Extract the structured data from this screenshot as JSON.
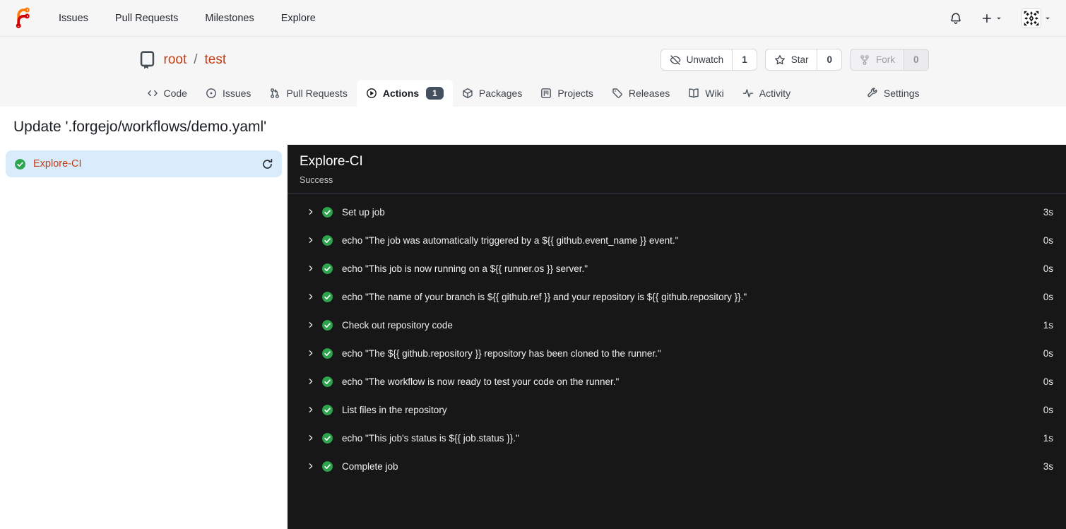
{
  "colors": {
    "accent_link": "#c53c14",
    "panel_bg": "#171717",
    "success_green": "#2da44e",
    "selected_job_bg": "#d9ecfc",
    "badge_bg": "#45505f"
  },
  "navbar": {
    "links": [
      {
        "label": "Issues"
      },
      {
        "label": "Pull Requests"
      },
      {
        "label": "Milestones"
      },
      {
        "label": "Explore"
      }
    ],
    "icons": {
      "logo": "forgejo-logo",
      "notifications": "bell-icon",
      "create_new": "plus-icon",
      "user_menu": "avatar-identicon"
    }
  },
  "repo_header": {
    "owner": "root",
    "separator": "/",
    "name": "test",
    "actions": [
      {
        "label": "Unwatch",
        "count": "1",
        "icon": "eye-slash",
        "disabled": false
      },
      {
        "label": "Star",
        "count": "0",
        "icon": "star",
        "disabled": false
      },
      {
        "label": "Fork",
        "count": "0",
        "icon": "fork",
        "disabled": true
      }
    ]
  },
  "tabs": [
    {
      "label": "Code",
      "icon": "code"
    },
    {
      "label": "Issues",
      "icon": "issue"
    },
    {
      "label": "Pull Requests",
      "icon": "pull-request"
    },
    {
      "label": "Actions",
      "icon": "play",
      "active": true,
      "badge": "1"
    },
    {
      "label": "Packages",
      "icon": "package"
    },
    {
      "label": "Projects",
      "icon": "project"
    },
    {
      "label": "Releases",
      "icon": "tag"
    },
    {
      "label": "Wiki",
      "icon": "book"
    },
    {
      "label": "Activity",
      "icon": "pulse"
    },
    {
      "label": "Settings",
      "icon": "tools",
      "align": "right"
    }
  ],
  "run": {
    "title": "Update '.forgejo/workflows/demo.yaml'"
  },
  "jobs_sidebar": {
    "items": [
      {
        "name": "Explore-CI",
        "status": "success",
        "selected": true
      }
    ]
  },
  "job_panel": {
    "title": "Explore-CI",
    "status": "Success",
    "steps": [
      {
        "name": "Set up job",
        "duration": "3s"
      },
      {
        "name": "echo \"The job was automatically triggered by a ${{ github.event_name }} event.\"",
        "duration": "0s"
      },
      {
        "name": "echo \"This job is now running on a ${{ runner.os }} server.\"",
        "duration": "0s"
      },
      {
        "name": "echo \"The name of your branch is ${{ github.ref }} and your repository is ${{ github.repository }}.\"",
        "duration": "0s"
      },
      {
        "name": "Check out repository code",
        "duration": "1s"
      },
      {
        "name": "echo \"The ${{ github.repository }} repository has been cloned to the runner.\"",
        "duration": "0s"
      },
      {
        "name": "echo \"The workflow is now ready to test your code on the runner.\"",
        "duration": "0s"
      },
      {
        "name": "List files in the repository",
        "duration": "0s"
      },
      {
        "name": "echo \"This job's status is ${{ job.status }}.\"",
        "duration": "1s"
      },
      {
        "name": "Complete job",
        "duration": "3s"
      }
    ]
  }
}
